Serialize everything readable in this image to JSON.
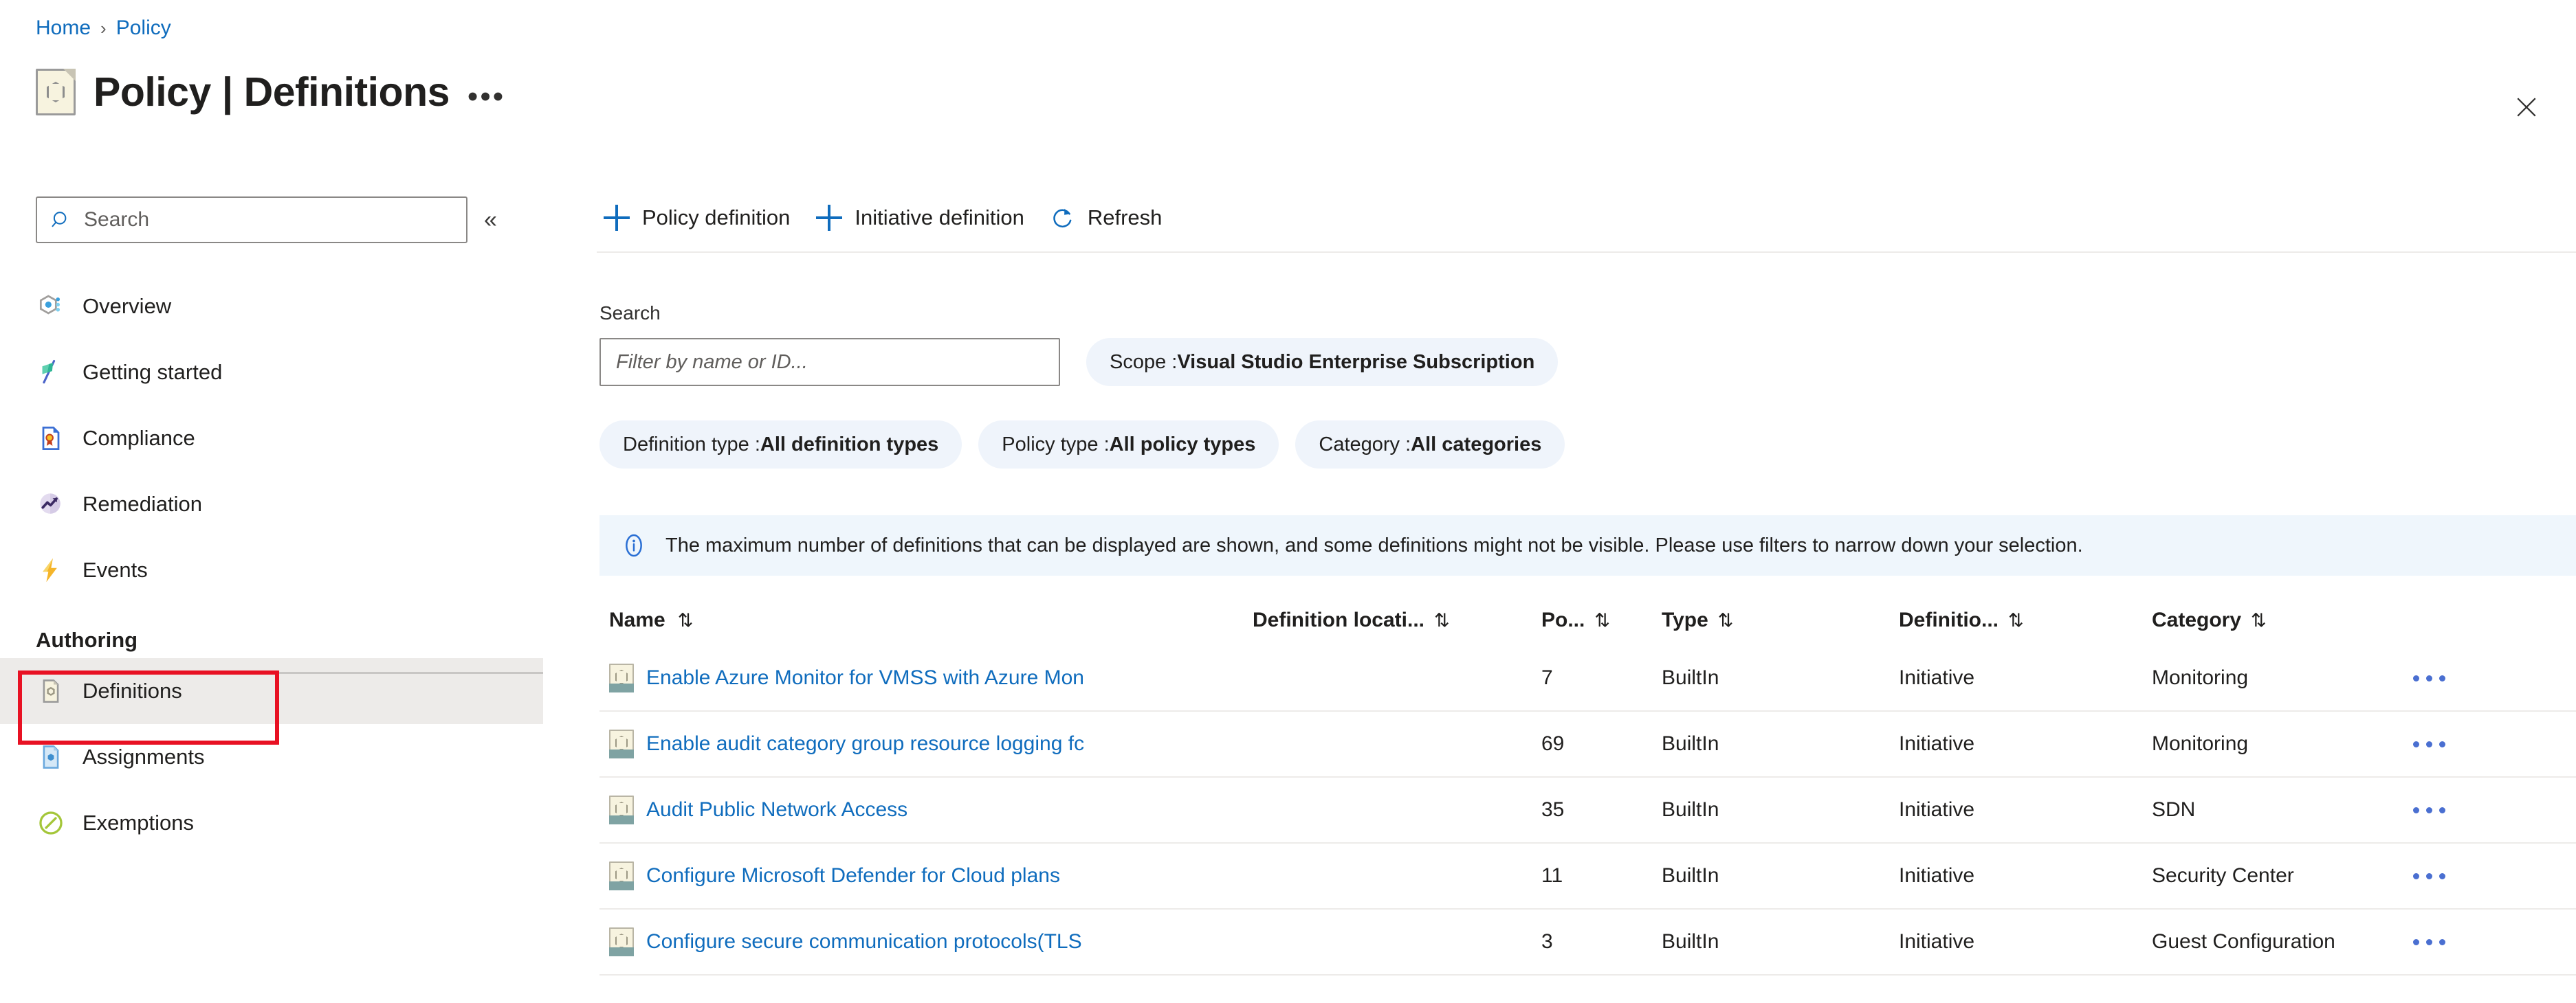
{
  "breadcrumb": {
    "home": "Home",
    "separator": "›",
    "current": "Policy"
  },
  "header": {
    "title": "Policy | Definitions",
    "icon": "policy-definition-icon",
    "more_ellipsis": "•••",
    "close_icon": "close-icon"
  },
  "sidebar": {
    "search_placeholder": "Search",
    "search_icon": "search-icon",
    "collapse_icon": "«",
    "items": [
      {
        "label": "Overview",
        "icon": "policy-overview-icon",
        "selected": false
      },
      {
        "label": "Getting started",
        "icon": "flag-icon",
        "selected": false
      },
      {
        "label": "Compliance",
        "icon": "compliance-badge-icon",
        "selected": false
      },
      {
        "label": "Remediation",
        "icon": "trend-up-icon",
        "selected": false
      },
      {
        "label": "Events",
        "icon": "lightning-bolt-icon",
        "selected": false
      }
    ],
    "section_label": "Authoring",
    "authoring_items": [
      {
        "label": "Definitions",
        "icon": "definitions-icon",
        "selected": true
      },
      {
        "label": "Assignments",
        "icon": "assignments-icon",
        "selected": false
      },
      {
        "label": "Exemptions",
        "icon": "exemptions-icon",
        "selected": false
      }
    ]
  },
  "toolbar": {
    "policy_definition": "Policy definition",
    "initiative_definition": "Initiative definition",
    "refresh": "Refresh",
    "refresh_icon": "refresh-icon",
    "add_icon": "plus-icon"
  },
  "search": {
    "label": "Search",
    "placeholder": "Filter by name or ID..."
  },
  "filters": {
    "scope": {
      "key": "Scope : ",
      "value": "Visual Studio Enterprise Subscription"
    },
    "definition_type": {
      "key": "Definition type : ",
      "value": "All definition types"
    },
    "policy_type": {
      "key": "Policy type : ",
      "value": "All policy types"
    },
    "category": {
      "key": "Category : ",
      "value": "All categories"
    }
  },
  "banner": {
    "icon": "info-icon",
    "text": "The maximum number of definitions that can be displayed are shown, and some definitions might not be visible. Please use filters to narrow down your selection."
  },
  "table": {
    "columns": [
      {
        "label": "Name",
        "sort": "⇅"
      },
      {
        "label": "Definition locati...",
        "sort": "⇅"
      },
      {
        "label": "Po...",
        "sort": "⇅"
      },
      {
        "label": "Type",
        "sort": "⇅"
      },
      {
        "label": "Definitio...",
        "sort": "⇅"
      },
      {
        "label": "Category",
        "sort": "⇅"
      }
    ],
    "rows": [
      {
        "name": "Enable Azure Monitor for VMSS with Azure Mon",
        "location": "",
        "policies": "7",
        "type": "BuiltIn",
        "definition_type": "Initiative",
        "category": "Monitoring",
        "menu": "•••"
      },
      {
        "name": "Enable audit category group resource logging fc",
        "location": "",
        "policies": "69",
        "type": "BuiltIn",
        "definition_type": "Initiative",
        "category": "Monitoring",
        "menu": "•••"
      },
      {
        "name": "Audit Public Network Access",
        "location": "",
        "policies": "35",
        "type": "BuiltIn",
        "definition_type": "Initiative",
        "category": "SDN",
        "menu": "•••"
      },
      {
        "name": "Configure Microsoft Defender for Cloud plans",
        "location": "",
        "policies": "11",
        "type": "BuiltIn",
        "definition_type": "Initiative",
        "category": "Security Center",
        "menu": "•••"
      },
      {
        "name": "Configure secure communication protocols(TLS",
        "location": "",
        "policies": "3",
        "type": "BuiltIn",
        "definition_type": "Initiative",
        "category": "Guest Configuration",
        "menu": "•••"
      }
    ]
  },
  "colors": {
    "link": "#0f6cbd",
    "pill_bg": "#eff4fb",
    "banner_bg": "#eff6fc",
    "selected_nav_bg": "#edebe9",
    "highlight_outline": "#e81123"
  }
}
